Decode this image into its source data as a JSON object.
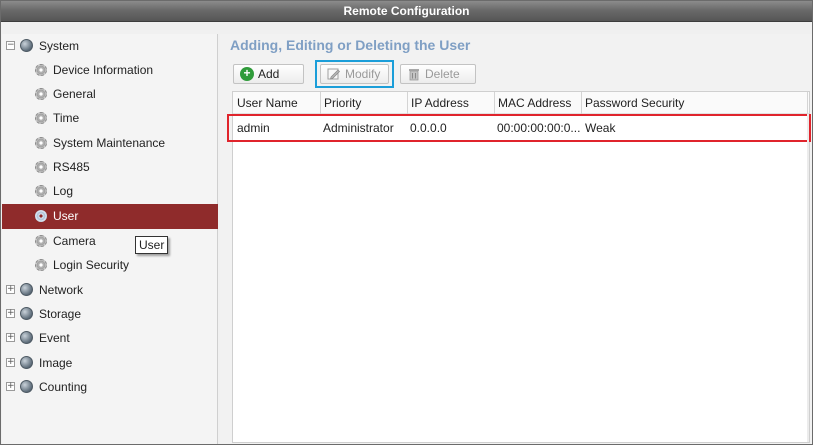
{
  "window": {
    "title": "Remote Configuration"
  },
  "sidebar": {
    "items": [
      {
        "label": "System",
        "level": 0,
        "expander": "−",
        "icon": "globe-icon"
      },
      {
        "label": "Device Information",
        "level": 1,
        "icon": "gear-icon"
      },
      {
        "label": "General",
        "level": 1,
        "icon": "gear-icon"
      },
      {
        "label": "Time",
        "level": 1,
        "icon": "gear-icon"
      },
      {
        "label": "System Maintenance",
        "level": 1,
        "icon": "gear-icon"
      },
      {
        "label": "RS485",
        "level": 1,
        "icon": "gear-icon"
      },
      {
        "label": "Log",
        "level": 1,
        "icon": "gear-icon"
      },
      {
        "label": "User",
        "level": 1,
        "icon": "gear-icon",
        "selected": true
      },
      {
        "label": "Camera",
        "level": 1,
        "icon": "gear-icon"
      },
      {
        "label": "Login Security",
        "level": 1,
        "icon": "gear-icon"
      },
      {
        "label": "Network",
        "level": 0,
        "expander": "+",
        "icon": "globe-icon"
      },
      {
        "label": "Storage",
        "level": 0,
        "expander": "+",
        "icon": "globe-icon"
      },
      {
        "label": "Event",
        "level": 0,
        "expander": "+",
        "icon": "globe-icon"
      },
      {
        "label": "Image",
        "level": 0,
        "expander": "+",
        "icon": "globe-icon"
      },
      {
        "label": "Counting",
        "level": 0,
        "expander": "+",
        "icon": "globe-icon"
      }
    ],
    "tooltip": "User"
  },
  "main": {
    "heading": "Adding, Editing or Deleting the User",
    "toolbar": {
      "add_label": "Add",
      "modify_label": "Modify",
      "delete_label": "Delete"
    },
    "table": {
      "columns": [
        "User Name",
        "Priority",
        "IP Address",
        "MAC Address",
        "Password Security"
      ],
      "rows": [
        [
          "admin",
          "Administrator",
          "0.0.0.0",
          "00:00:00:00:0...",
          "Weak"
        ]
      ]
    }
  },
  "colors": {
    "selected_bg": "#8f2b2b",
    "heading": "#7f9fc4",
    "highlight_blue": "#1b9ed9",
    "highlight_red": "#e0242c",
    "add_icon": "#2f9b3a"
  }
}
